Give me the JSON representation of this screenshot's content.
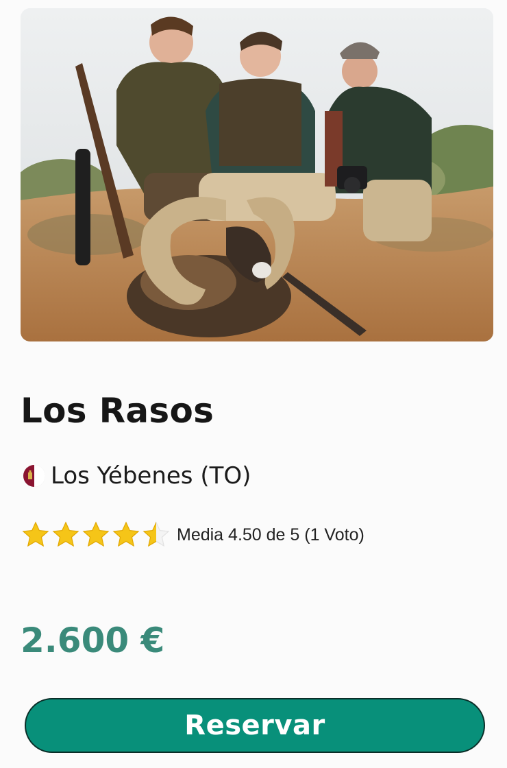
{
  "listing": {
    "title": "Los Rasos",
    "location": "Los Yébenes (TO)",
    "region_flag_icon": "castilla-la-mancha-flag-icon",
    "rating": {
      "value": 4.5,
      "max": 5,
      "text": "Media 4.50 de 5 (1 Voto)"
    },
    "price": "2.600 €",
    "reserve_label": "Reservar"
  },
  "colors": {
    "price": "#3a8a7a",
    "button": "#08907a",
    "star": "#f5c518"
  }
}
